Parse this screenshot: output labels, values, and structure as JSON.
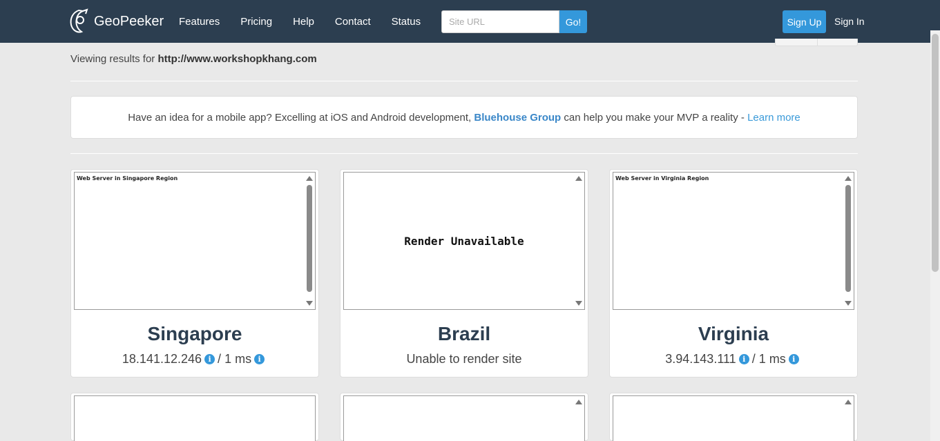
{
  "nav": {
    "brand": "GeoPeeker",
    "links": [
      "Features",
      "Pricing",
      "Help",
      "Contact",
      "Status"
    ],
    "search_placeholder": "Site URL",
    "go_label": "Go!",
    "signup_label": "Sign Up",
    "signin_label": "Sign In"
  },
  "viewing": {
    "prefix": "Viewing results for",
    "url": "http://www.workshopkhang.com"
  },
  "promo": {
    "text_before": "Have an idea for a mobile app? Excelling at iOS and Android development,",
    "company": "Bluehouse Group",
    "text_after": "can help you make your MVP a reality -",
    "link": "Learn more"
  },
  "cards": [
    {
      "region_text": "Web Server in Singapore Region",
      "city": "Singapore",
      "ip": "18.141.12.246",
      "sep": "/",
      "latency": "1 ms"
    },
    {
      "render_text": "Render Unavailable",
      "city": "Brazil",
      "status": "Unable to render site"
    },
    {
      "region_text": "Web Server in Virginia Region",
      "city": "Virginia",
      "ip": "3.94.143.111",
      "sep": "/",
      "latency": "1 ms"
    }
  ],
  "icons": {
    "info": "i"
  },
  "colors": {
    "navbar": "#2c3e50",
    "accent": "#3498db",
    "city": "#2c3e50"
  }
}
